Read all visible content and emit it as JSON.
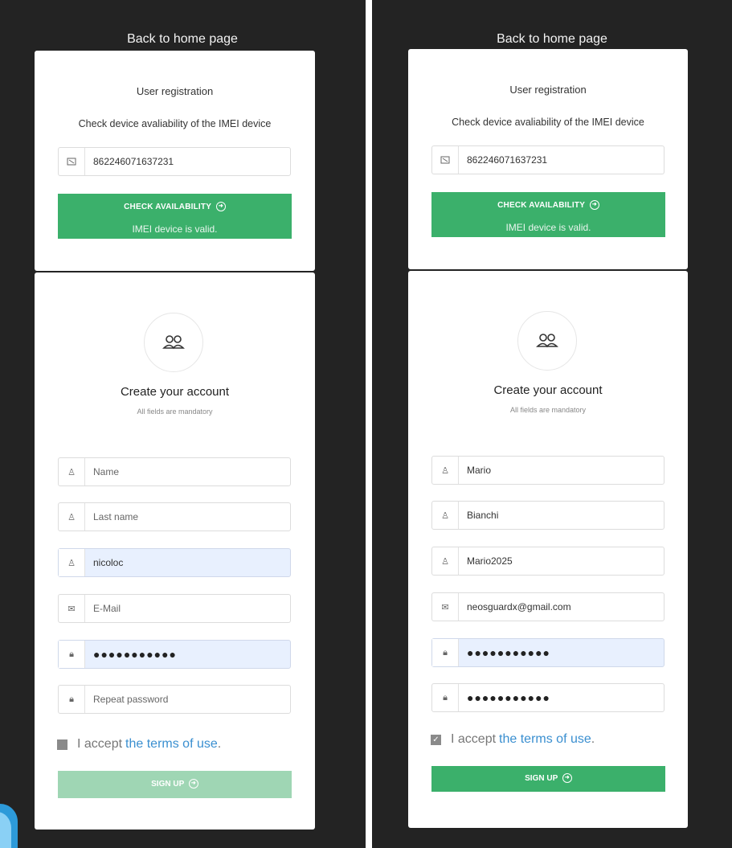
{
  "colors": {
    "green": "#3bb06b",
    "green_disabled": "#9fd6b4",
    "background": "#232323",
    "link": "#3a8fd0",
    "autofill": "#e8f0fe"
  },
  "panels": [
    {
      "back_link": "Back to home page",
      "registration": {
        "title": "User registration",
        "subtitle": "Check device avaliability of the IMEI device",
        "imei_value": "862246071637231",
        "check_button": "CHECK AVAILABILITY",
        "status": "IMEI device is valid."
      },
      "account": {
        "title": "Create your account",
        "subtitle": "All fields are mandatory",
        "fields": [
          {
            "icon": "user-icon",
            "text": "Name",
            "placeholder": true
          },
          {
            "icon": "user-icon",
            "text": "Last name",
            "placeholder": true
          },
          {
            "icon": "user-icon",
            "text": "nicoloc",
            "placeholder": false
          },
          {
            "icon": "envelope-icon",
            "text": "E-Mail",
            "placeholder": true
          },
          {
            "icon": "lock-icon",
            "text": "●●●●●●●●●●●",
            "placeholder": false
          },
          {
            "icon": "lock-icon",
            "text": "Repeat password",
            "placeholder": true
          }
        ],
        "terms_prefix": "I accept",
        "terms_link": "the terms of use",
        "terms_suffix": ".",
        "terms_checked": false,
        "signup_button": "SIGN UP"
      }
    },
    {
      "back_link": "Back to home page",
      "registration": {
        "title": "User registration",
        "subtitle": "Check device avaliability of the IMEI device",
        "imei_value": "862246071637231",
        "check_button": "CHECK AVAILABILITY",
        "status": "IMEI device is valid."
      },
      "account": {
        "title": "Create your account",
        "subtitle": "All fields are mandatory",
        "fields": [
          {
            "icon": "user-icon",
            "text": "Mario",
            "placeholder": false
          },
          {
            "icon": "user-icon",
            "text": "Bianchi",
            "placeholder": false
          },
          {
            "icon": "user-icon",
            "text": "Mario2025",
            "placeholder": false
          },
          {
            "icon": "envelope-icon",
            "text": "neosguardx@gmail.com",
            "placeholder": false
          },
          {
            "icon": "lock-icon",
            "text": "●●●●●●●●●●●",
            "placeholder": false
          },
          {
            "icon": "lock-icon",
            "text": "●●●●●●●●●●●",
            "placeholder": false
          }
        ],
        "terms_prefix": "I accept",
        "terms_link": "the terms of use",
        "terms_suffix": ".",
        "terms_checked": true,
        "signup_button": "SIGN UP"
      }
    }
  ]
}
